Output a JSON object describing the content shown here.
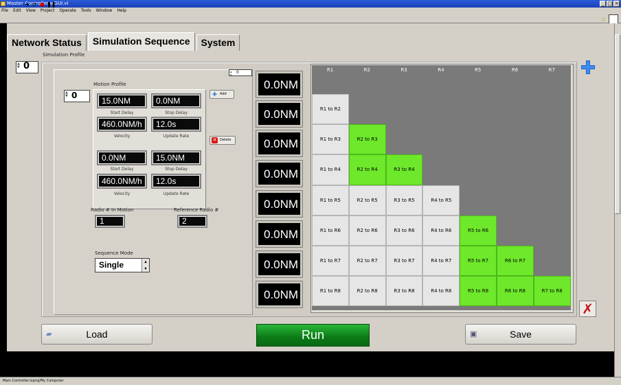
{
  "window": {
    "title": "Master Controller wGUI.vi",
    "buttons": [
      "_",
      "□",
      "×"
    ]
  },
  "menu": [
    "File",
    "Edit",
    "View",
    "Project",
    "Operate",
    "Tools",
    "Window",
    "Help"
  ],
  "tabs": [
    "Network Status",
    "Simulation Sequence",
    "System"
  ],
  "simulation_profile": {
    "label": "Simulation Profile",
    "index": "0"
  },
  "motion_profile": {
    "label": "Motion Profile",
    "index": "0",
    "top_index": "0",
    "add_label": "Add",
    "delete_label": "Delete",
    "block1": {
      "start": "15.0NM",
      "stop": "0.0NM",
      "start_delay_lbl": "Start Delay",
      "stop_delay_lbl": "Stop Delay",
      "velocity": "460.0NM/h",
      "update_rate": "12.0s",
      "velocity_lbl": "Velocity",
      "update_rate_lbl": "Update Rate"
    },
    "block2": {
      "start": "0.0NM",
      "stop": "15.0NM",
      "start_delay_lbl": "Start Delay",
      "stop_delay_lbl": "Stop Delay",
      "velocity": "460.0NM/h",
      "update_rate": "12.0s",
      "velocity_lbl": "Velocity",
      "update_rate_lbl": "Update Rate"
    }
  },
  "radio_in_motion": {
    "label": "Radio # In Motion",
    "value": "1"
  },
  "reference_radio": {
    "label": "Reference Radio #",
    "value": "2"
  },
  "sequence_mode": {
    "label": "Sequence Mode",
    "value": "Single"
  },
  "distances": [
    "0.0NM",
    "0.0NM",
    "0.0NM",
    "0.0NM",
    "0.0NM",
    "0.0NM",
    "0.0NM",
    "0.0NM"
  ],
  "grid": {
    "headers": [
      "R1",
      "R2",
      "R3",
      "R4",
      "R5",
      "R6",
      "R7"
    ],
    "rows": [
      [
        "R1 to R2"
      ],
      [
        "R1 to R3",
        "R2 to R3"
      ],
      [
        "R1 to R4",
        "R2 to R4",
        "R3 to R4"
      ],
      [
        "R1 to R5",
        "R2 to R5",
        "R3 to R5",
        "R4 to R5"
      ],
      [
        "R1 to R6",
        "R2 to R6",
        "R3 to R6",
        "R4 to R6",
        "R5 to R6"
      ],
      [
        "R1 to R7",
        "R2 to R7",
        "R3 to R7",
        "R4 to R7",
        "R5 to R7",
        "R6 to R7"
      ],
      [
        "R1 to R8",
        "R2 to R8",
        "R3 to R8",
        "R4 to R8",
        "R5 to R8",
        "R6 to R8",
        "R7 to R8"
      ]
    ],
    "highlighted": [
      "R2 to R3",
      "R2 to R4",
      "R3 to R4",
      "R5 to R6",
      "R5 to R7",
      "R6 to R7",
      "R5 to R8",
      "R6 to R8",
      "R7 to R8"
    ],
    "colors": {
      "highlight": "#6de82a",
      "normal": "#e6e6e6",
      "background": "#7a7a7a"
    }
  },
  "buttons": {
    "load": "Load",
    "run": "Run",
    "save": "Save"
  },
  "status_bar": "Main Controller.lvproj/My Computer"
}
